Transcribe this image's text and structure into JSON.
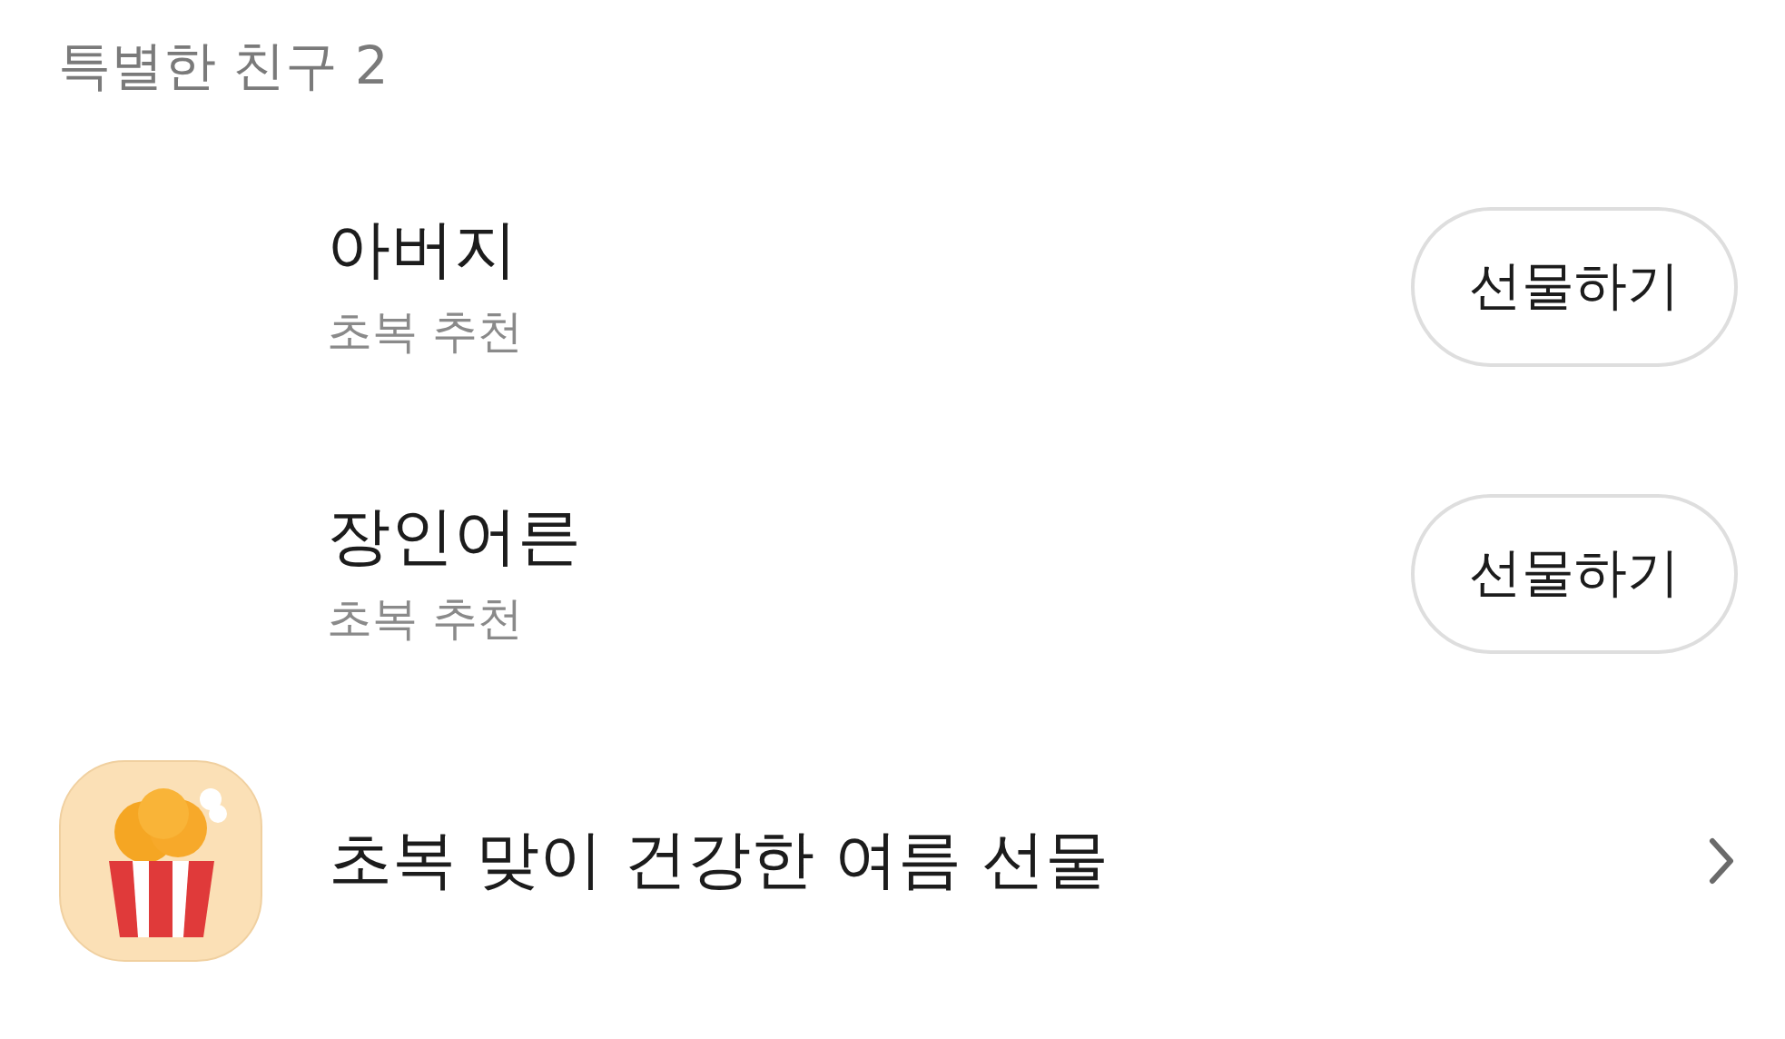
{
  "section_title": "특별한 친구 2",
  "friends": [
    {
      "name": "아버지",
      "subtitle": "초복 추천",
      "button": "선물하기"
    },
    {
      "name": "장인어른",
      "subtitle": "초복 추천",
      "button": "선물하기"
    }
  ],
  "banner": {
    "text": "초복 맞이 건강한 여름 선물"
  }
}
